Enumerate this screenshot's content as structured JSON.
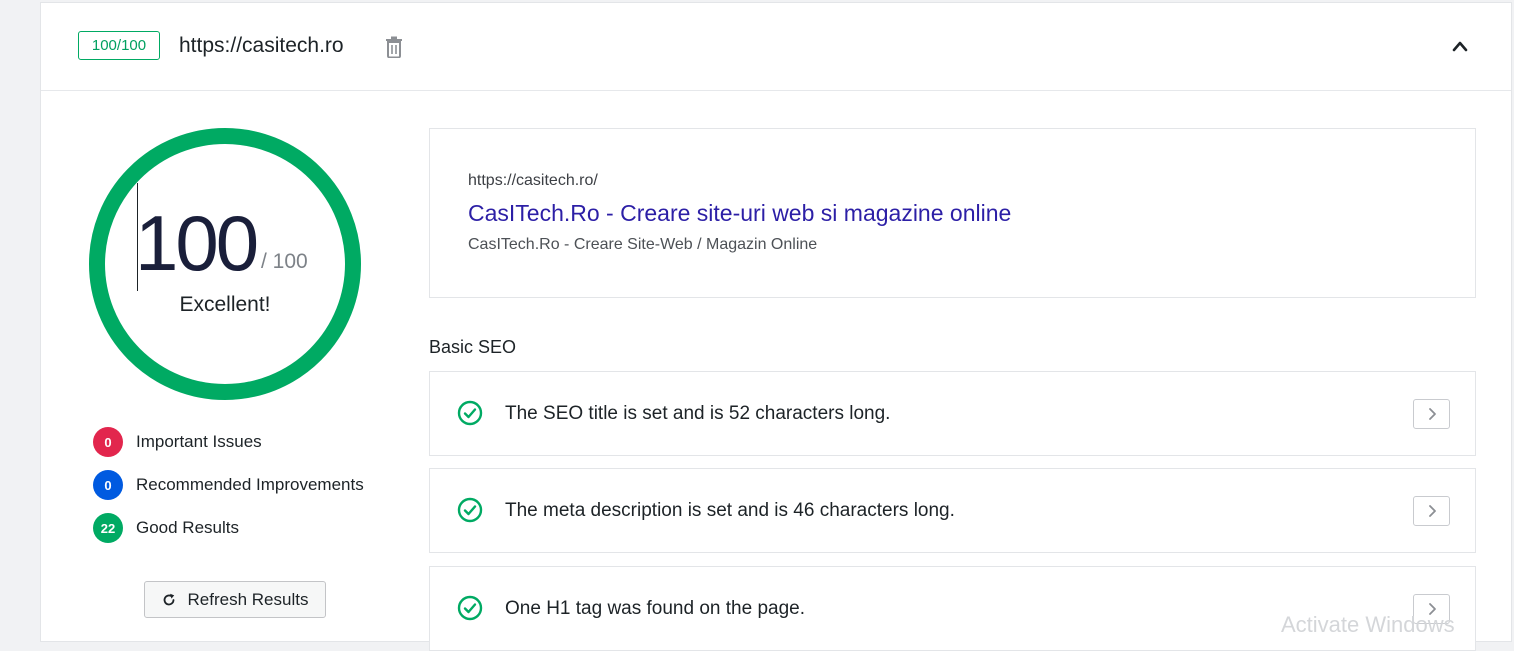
{
  "header": {
    "score_badge": "100/100",
    "site_url": "https://casitech.ro",
    "delete_icon": "trash-icon",
    "collapse_icon": "chevron-up-icon"
  },
  "score": {
    "value": "100",
    "max": "/ 100",
    "rating": "Excellent!",
    "fraction": 1.0,
    "ring_color": "#00aa63"
  },
  "summary": [
    {
      "count": "0",
      "label": "Important Issues",
      "color": "#e2264d"
    },
    {
      "count": "0",
      "label": "Recommended Improvements",
      "color": "#005ae0"
    },
    {
      "count": "22",
      "label": "Good Results",
      "color": "#00aa63"
    }
  ],
  "refresh_button": {
    "label": "Refresh Results",
    "icon": "refresh-icon"
  },
  "serp_preview": {
    "url": "https://casitech.ro/",
    "title": "CasITech.Ro - Creare site-uri web si magazine online",
    "description": "CasITech.Ro - Creare Site-Web / Magazin Online"
  },
  "basic_seo": {
    "title": "Basic SEO",
    "items": [
      {
        "label": "The SEO title is set and is 52 characters long.",
        "status": "good"
      },
      {
        "label": "The meta description is set and is 46 characters long.",
        "status": "good"
      },
      {
        "label": "One H1 tag was found on the page.",
        "status": "good"
      }
    ]
  },
  "watermark": "Activate Windows"
}
